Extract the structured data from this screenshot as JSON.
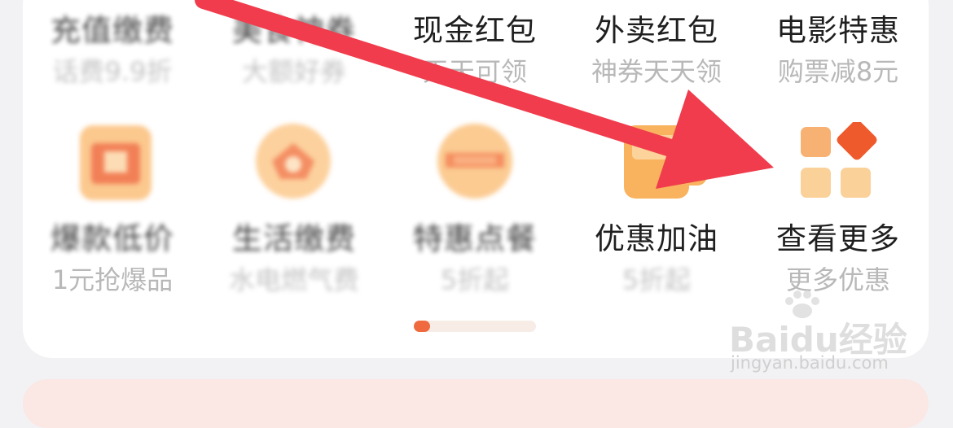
{
  "row1": [
    {
      "title": "充值缴费",
      "sub": "话费9.9折"
    },
    {
      "title": "美食神券",
      "sub": "大额好券"
    },
    {
      "title": "现金红包",
      "sub": "天天可领"
    },
    {
      "title": "外卖红包",
      "sub": "神券天天领"
    },
    {
      "title": "电影特惠",
      "sub": "购票减8元"
    }
  ],
  "row2": [
    {
      "title": "爆款低价",
      "sub": "1元抢爆品",
      "icon": "shopping-bag-icon"
    },
    {
      "title": "生活缴费",
      "sub": "水电燃气费",
      "icon": "home-service-icon"
    },
    {
      "title": "特惠点餐",
      "sub": "5折起",
      "icon": "food-plate-icon"
    },
    {
      "title": "优惠加油",
      "sub": "5折起",
      "icon": "fuel-cup-icon"
    },
    {
      "title": "查看更多",
      "sub": "更多优惠",
      "icon": "grid-more-icon"
    }
  ],
  "pager": {
    "current": 1,
    "total": 2
  },
  "watermark": {
    "brand": "Baidu经验",
    "url": "jingyan.baidu.com"
  },
  "colors": {
    "accent": "#ef6a3e",
    "arrow": "#f03c4c",
    "icon_light": "#fbd9a6",
    "icon_dark": "#f07a3c"
  }
}
